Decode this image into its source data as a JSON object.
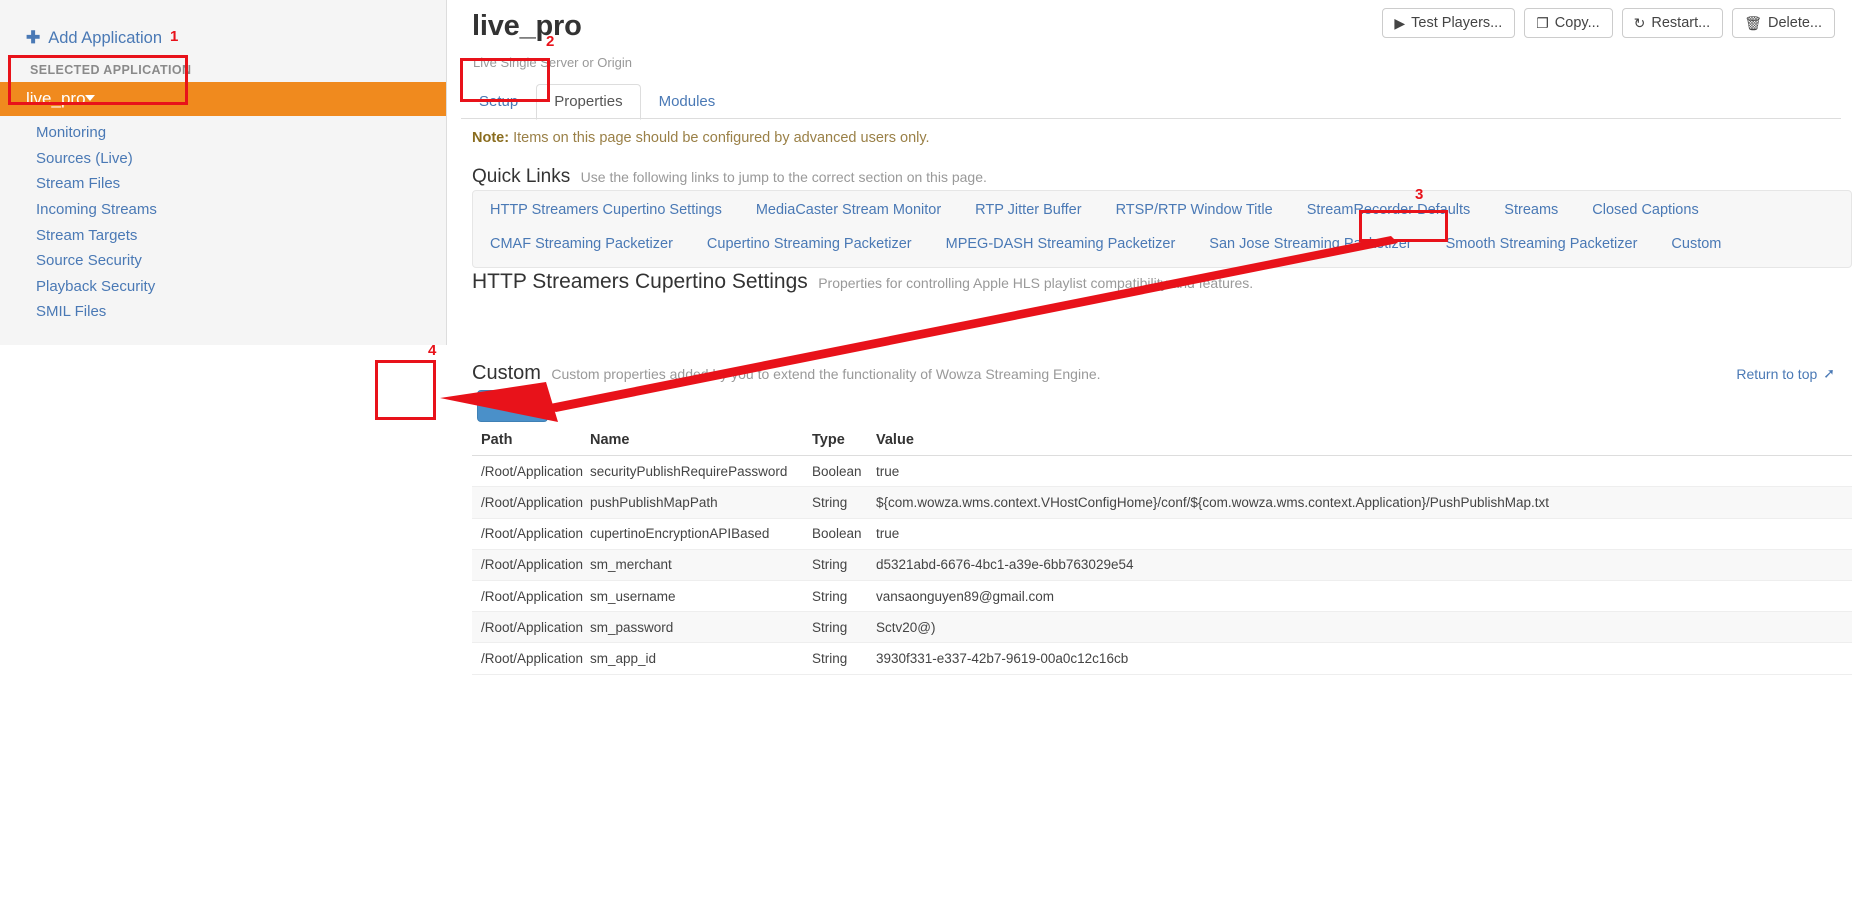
{
  "sidebar": {
    "add_application": "Add Application",
    "add_icon": "plus-icon",
    "selected_application_label": "SELECTED APPLICATION",
    "selected_application_name": "live_pro",
    "items": [
      {
        "label": "Monitoring"
      },
      {
        "label": "Sources (Live)"
      },
      {
        "label": "Stream Files"
      },
      {
        "label": "Incoming Streams"
      },
      {
        "label": "Stream Targets"
      },
      {
        "label": "Source Security"
      },
      {
        "label": "Playback Security"
      },
      {
        "label": "SMIL Files"
      }
    ]
  },
  "header": {
    "title": "live_pro",
    "subtitle": "Live Single Server or Origin",
    "buttons": [
      {
        "label": "Test Players...",
        "icon": "play-icon",
        "glyph": "▶"
      },
      {
        "label": "Copy...",
        "icon": "copy-icon",
        "glyph": "❐"
      },
      {
        "label": "Restart...",
        "icon": "restart-icon",
        "glyph": "↻"
      },
      {
        "label": "Delete...",
        "icon": "trash-icon",
        "glyph": "🗑"
      }
    ]
  },
  "tabs": [
    {
      "label": "Setup",
      "active": false
    },
    {
      "label": "Properties",
      "active": true
    },
    {
      "label": "Modules",
      "active": false
    }
  ],
  "note": {
    "prefix": "Note:",
    "text": "Items on this page should be configured by advanced users only."
  },
  "quick_links": {
    "heading": "Quick Links",
    "description": "Use the following links to jump to the correct section on this page.",
    "row1": [
      "HTTP Streamers Cupertino Settings",
      "MediaCaster Stream Monitor",
      "RTP Jitter Buffer",
      "RTSP/RTP Window Title",
      "StreamRecorder Defaults",
      "Streams",
      "Closed Captions"
    ],
    "row2": [
      "CMAF Streaming Packetizer",
      "Cupertino Streaming Packetizer",
      "MPEG-DASH Streaming Packetizer",
      "San Jose Streaming Packetizer",
      "Smooth Streaming Packetizer",
      "Custom"
    ]
  },
  "section": {
    "heading": "HTTP Streamers Cupertino Settings",
    "description": "Properties for controlling Apple HLS playlist compatibility and features."
  },
  "custom": {
    "heading": "Custom",
    "description": "Custom properties added by you to extend the functionality of Wowza Streaming Engine.",
    "return_to_top": "Return to top",
    "return_icon": "arrow-up-icon",
    "edit_label": "Edit",
    "edit_icon": "pencil-icon",
    "columns": [
      "Path",
      "Name",
      "Type",
      "Value"
    ],
    "rows": [
      {
        "path": "/Root/Application",
        "name": "securityPublishRequirePassword",
        "type": "Boolean",
        "value": "true"
      },
      {
        "path": "/Root/Application",
        "name": "pushPublishMapPath",
        "type": "String",
        "value": "${com.wowza.wms.context.VHostConfigHome}/conf/${com.wowza.wms.context.Application}/PushPublishMap.txt"
      },
      {
        "path": "/Root/Application",
        "name": "cupertinoEncryptionAPIBased",
        "type": "Boolean",
        "value": "true"
      },
      {
        "path": "/Root/Application",
        "name": "sm_merchant",
        "type": "String",
        "value": "d5321abd-6676-4bc1-a39e-6bb763029e54"
      },
      {
        "path": "/Root/Application",
        "name": "sm_username",
        "type": "String",
        "value": "vansaonguyen89@gmail.com"
      },
      {
        "path": "/Root/Application",
        "name": "sm_password",
        "type": "String",
        "value": "Sctv20@)"
      },
      {
        "path": "/Root/Application",
        "name": "sm_app_id",
        "type": "String",
        "value": "3930f331-e337-42b7-9619-00a0c12c16cb"
      }
    ]
  },
  "annotations": {
    "color": "#e8121a",
    "markers": [
      {
        "number": "1",
        "target": "selected-application"
      },
      {
        "number": "2",
        "target": "properties-tab"
      },
      {
        "number": "3",
        "target": "custom-quick-link"
      },
      {
        "number": "4",
        "target": "custom-edit-button"
      }
    ]
  }
}
